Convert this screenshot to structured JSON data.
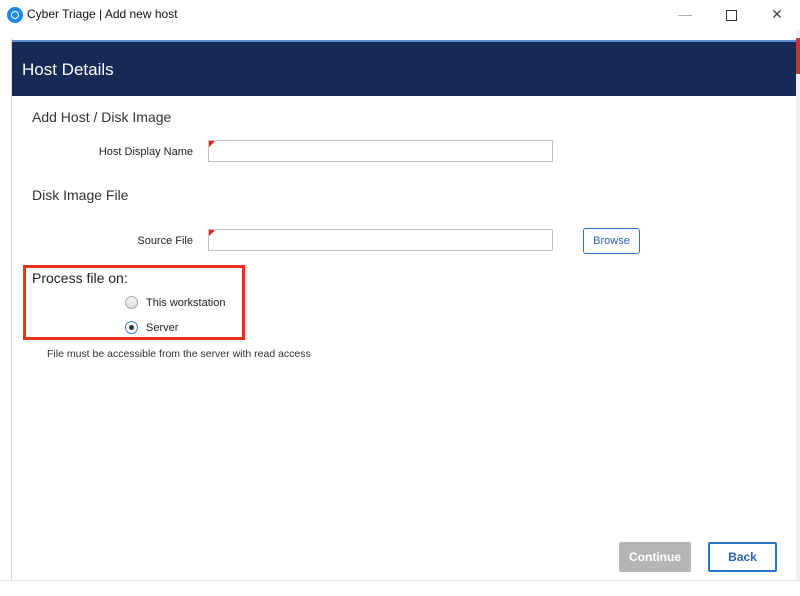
{
  "window": {
    "title": "Cyber Triage | Add new host",
    "minimize": "—",
    "close": "✕"
  },
  "header": {
    "title": "Host Details"
  },
  "form": {
    "section_host": "Add Host / Disk Image",
    "host_display_name_label": "Host Display Name",
    "host_display_name_value": "",
    "section_disk": "Disk Image File",
    "source_file_label": "Source File",
    "source_file_value": "",
    "browse_label": "Browse"
  },
  "process": {
    "label": "Process file on:",
    "options": [
      "This workstation",
      "Server"
    ],
    "selected": "Server",
    "note": "File must be accessible from the server with read access"
  },
  "footer": {
    "continue_label": "Continue",
    "back_label": "Back"
  },
  "colors": {
    "header_bg": "#172a55",
    "accent": "#2a72c9",
    "highlight": "#e8331c",
    "required": "#e0201b"
  }
}
